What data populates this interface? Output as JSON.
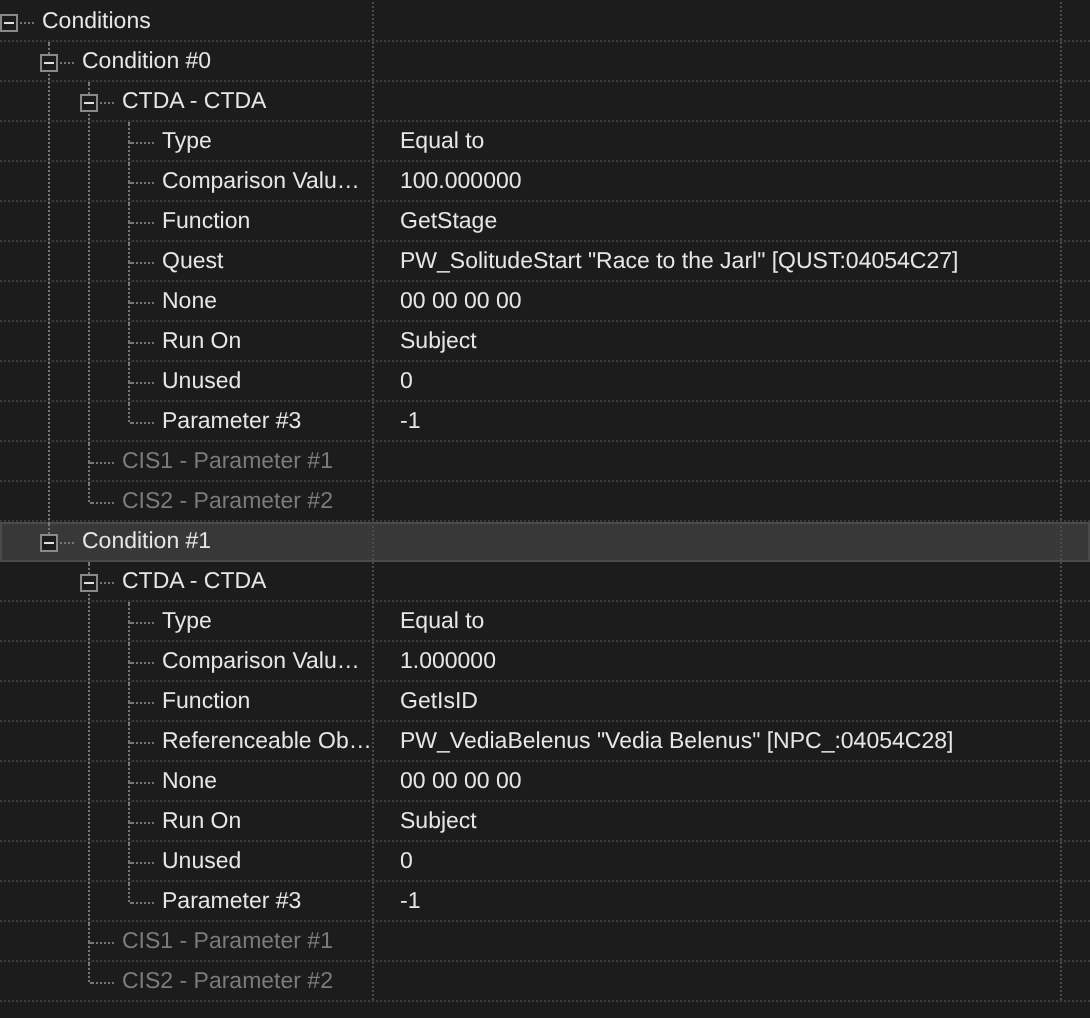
{
  "tree": [
    {
      "label": "Conditions",
      "expanded": true,
      "selected": false,
      "disabled": false,
      "children": [
        {
          "label": "Condition #0",
          "expanded": true,
          "selected": false,
          "disabled": false,
          "children": [
            {
              "label": "CTDA - CTDA",
              "expanded": true,
              "selected": false,
              "disabled": false,
              "children": [
                {
                  "label": "Type",
                  "value": "Equal to",
                  "selected": false,
                  "disabled": false
                },
                {
                  "label": "Comparison Valu…",
                  "value": "100.000000",
                  "selected": false,
                  "disabled": false
                },
                {
                  "label": "Function",
                  "value": "GetStage",
                  "selected": false,
                  "disabled": false
                },
                {
                  "label": "Quest",
                  "value": "PW_SolitudeStart \"Race to the Jarl\" [QUST:04054C27]",
                  "selected": false,
                  "disabled": false
                },
                {
                  "label": "None",
                  "value": "00 00 00 00",
                  "selected": false,
                  "disabled": false
                },
                {
                  "label": "Run On",
                  "value": "Subject",
                  "selected": false,
                  "disabled": false
                },
                {
                  "label": "Unused",
                  "value": "0",
                  "selected": false,
                  "disabled": false
                },
                {
                  "label": "Parameter #3",
                  "value": "-1",
                  "selected": false,
                  "disabled": false
                }
              ]
            },
            {
              "label": "CIS1 - Parameter #1",
              "selected": false,
              "disabled": true
            },
            {
              "label": "CIS2 - Parameter #2",
              "selected": false,
              "disabled": true
            }
          ]
        },
        {
          "label": "Condition #1",
          "expanded": true,
          "selected": true,
          "disabled": false,
          "children": [
            {
              "label": "CTDA - CTDA",
              "expanded": true,
              "selected": false,
              "disabled": false,
              "children": [
                {
                  "label": "Type",
                  "value": "Equal to",
                  "selected": false,
                  "disabled": false
                },
                {
                  "label": "Comparison Valu…",
                  "value": "1.000000",
                  "selected": false,
                  "disabled": false
                },
                {
                  "label": "Function",
                  "value": "GetIsID",
                  "selected": false,
                  "disabled": false
                },
                {
                  "label": "Referenceable Ob…",
                  "value": "PW_VediaBelenus \"Vedia Belenus\" [NPC_:04054C28]",
                  "selected": false,
                  "disabled": false
                },
                {
                  "label": "None",
                  "value": "00 00 00 00",
                  "selected": false,
                  "disabled": false
                },
                {
                  "label": "Run On",
                  "value": "Subject",
                  "selected": false,
                  "disabled": false
                },
                {
                  "label": "Unused",
                  "value": "0",
                  "selected": false,
                  "disabled": false
                },
                {
                  "label": "Parameter #3",
                  "value": "-1",
                  "selected": false,
                  "disabled": false
                }
              ]
            },
            {
              "label": "CIS1 - Parameter #1",
              "selected": false,
              "disabled": true
            },
            {
              "label": "CIS2 - Parameter #2",
              "selected": false,
              "disabled": true
            }
          ]
        }
      ]
    }
  ]
}
